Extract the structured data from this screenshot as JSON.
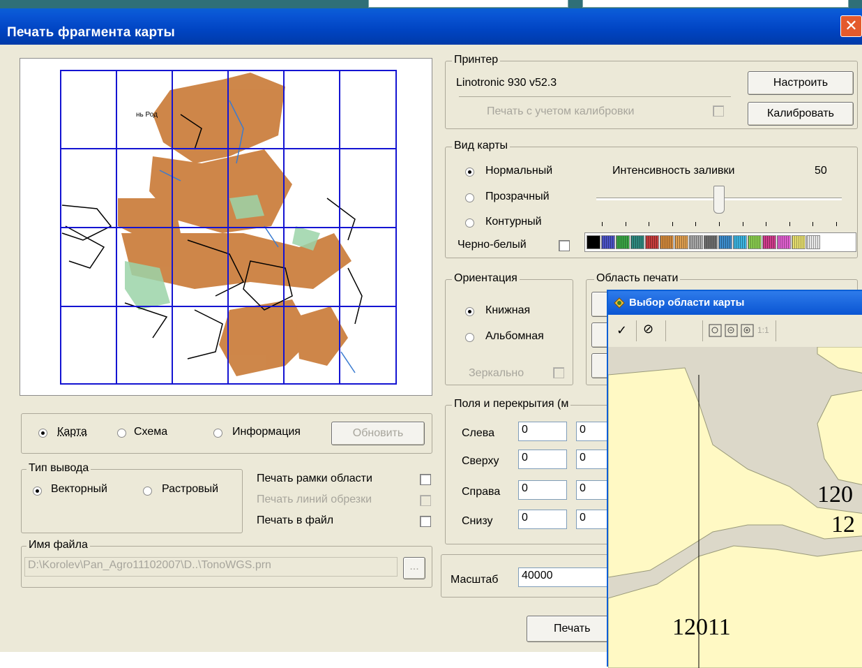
{
  "dialog": {
    "title": "Печать фрагмента карты",
    "close_glyph": "✕"
  },
  "preview": {
    "place_label": "нь Род"
  },
  "view_mode": {
    "map": "Карта",
    "scheme": "Схема",
    "info": "Информация",
    "refresh": "Обновить"
  },
  "output_type": {
    "legend": "Тип вывода",
    "vector": "Векторный",
    "raster": "Растровый"
  },
  "print_options": {
    "frame": "Печать рамки области",
    "cut_lines": "Печать линий обрезки",
    "to_file": "Печать в файл"
  },
  "file_name": {
    "legend": "Имя файла",
    "value": "D:\\Korolev\\Pan_Agro11102007\\D..\\TonoWGS.prn",
    "browse": "..."
  },
  "printer": {
    "legend": "Принтер",
    "name": "Linotronic 930 v52.3",
    "setup": "Настроить",
    "calibration_print": "Печать с учетом калибровки",
    "calibrate": "Калибровать"
  },
  "map_view": {
    "legend": "Вид карты",
    "normal": "Нормальный",
    "transparent": "Прозрачный",
    "contour": "Контурный",
    "black_white": "Черно-белый",
    "intensity_label": "Интенсивность заливки",
    "intensity_value": "50",
    "intensity": 0.5,
    "palette": [
      "#000000",
      "#4a52c4",
      "#3aa646",
      "#2f8a80",
      "#c43c3c",
      "#d48a3c",
      "#e0a050",
      "#a8a8a8",
      "#707070",
      "#3c8ccc",
      "#3cb4e0",
      "#8cd050",
      "#d03c8c",
      "#e060d0",
      "#e8e070",
      "#e8e8e8"
    ]
  },
  "orientation": {
    "legend": "Ориентация",
    "portrait": "Книжная",
    "landscape": "Альбомная",
    "mirror": "Зеркально"
  },
  "print_area": {
    "legend": "Область печати"
  },
  "margins": {
    "legend": "Поля и перекрытия (м",
    "rows": [
      {
        "label": "Слева",
        "a": "0",
        "b": "0"
      },
      {
        "label": "Сверху",
        "a": "0",
        "b": "0"
      },
      {
        "label": "Справа",
        "a": "0",
        "b": "0"
      },
      {
        "label": "Снизу",
        "a": "0",
        "b": "0"
      }
    ]
  },
  "scale": {
    "label": "Масштаб",
    "value": "40000"
  },
  "print_button": "Печать",
  "area_window": {
    "title": "Выбор области карты",
    "ok_glyph": "✓",
    "cancel_glyph": "⊘",
    "scale_1_1": "1:1",
    "labels": [
      "120",
      "12",
      "12011"
    ]
  }
}
